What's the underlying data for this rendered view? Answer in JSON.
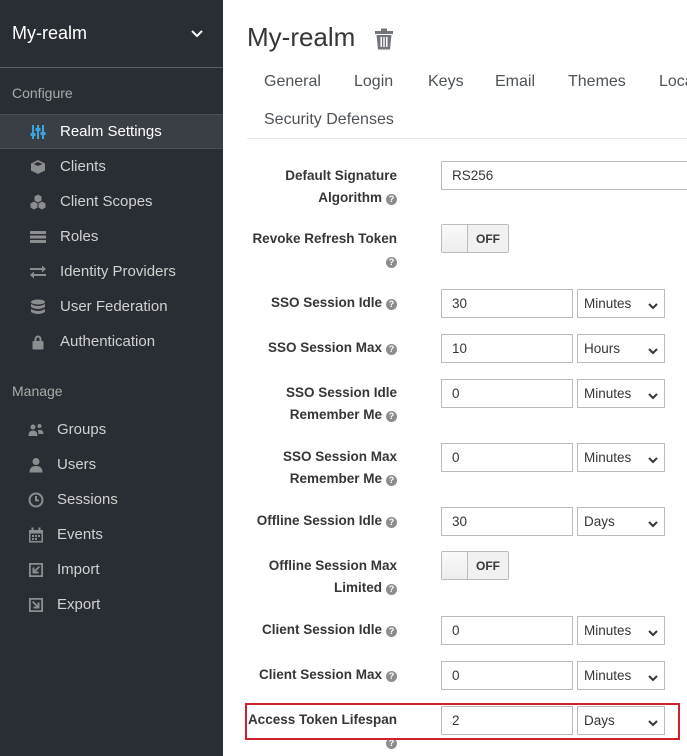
{
  "sidebar": {
    "realm_name": "My-realm",
    "configure_title": "Configure",
    "manage_title": "Manage",
    "configure_items": [
      {
        "label": "Realm Settings",
        "icon": "sliders-icon",
        "active": true
      },
      {
        "label": "Clients",
        "icon": "cube-icon"
      },
      {
        "label": "Client Scopes",
        "icon": "cubes-icon"
      },
      {
        "label": "Roles",
        "icon": "roles-icon"
      },
      {
        "label": "Identity Providers",
        "icon": "exchange-icon"
      },
      {
        "label": "User Federation",
        "icon": "database-icon"
      },
      {
        "label": "Authentication",
        "icon": "lock-icon"
      }
    ],
    "manage_items": [
      {
        "label": "Groups",
        "icon": "users-icon"
      },
      {
        "label": "Users",
        "icon": "user-icon"
      },
      {
        "label": "Sessions",
        "icon": "clock-icon"
      },
      {
        "label": "Events",
        "icon": "calendar-icon"
      },
      {
        "label": "Import",
        "icon": "import-icon"
      },
      {
        "label": "Export",
        "icon": "export-icon"
      }
    ]
  },
  "main": {
    "title": "My-realm",
    "tabs": [
      "General",
      "Login",
      "Keys",
      "Email",
      "Themes",
      "Localization",
      "Security Defenses"
    ],
    "fields": {
      "default_signature": {
        "label1": "Default Signature",
        "label2": "Algorithm",
        "value": "RS256"
      },
      "revoke_refresh": {
        "label1": "Revoke Refresh Token",
        "toggle": "OFF"
      },
      "sso_idle": {
        "label": "SSO Session Idle",
        "value": "30",
        "unit": "Minutes"
      },
      "sso_max": {
        "label": "SSO Session Max",
        "value": "10",
        "unit": "Hours"
      },
      "sso_idle_rm": {
        "label1": "SSO Session Idle",
        "label2": "Remember Me",
        "value": "0",
        "unit": "Minutes"
      },
      "sso_max_rm": {
        "label1": "SSO Session Max",
        "label2": "Remember Me",
        "value": "0",
        "unit": "Minutes"
      },
      "offline_idle": {
        "label": "Offline Session Idle",
        "value": "30",
        "unit": "Days"
      },
      "offline_max_limited": {
        "label1": "Offline Session Max",
        "label2": "Limited",
        "toggle": "OFF"
      },
      "client_idle": {
        "label": "Client Session Idle",
        "value": "0",
        "unit": "Minutes"
      },
      "client_max": {
        "label": "Client Session Max",
        "value": "0",
        "unit": "Minutes"
      },
      "access_token": {
        "label": "Access Token Lifespan",
        "value": "2",
        "unit": "Days"
      }
    },
    "help_glyph": "?"
  },
  "colors": {
    "sidebar_bg": "#292e34",
    "active_item_bg": "#393f44",
    "highlight": "#d0202e"
  }
}
